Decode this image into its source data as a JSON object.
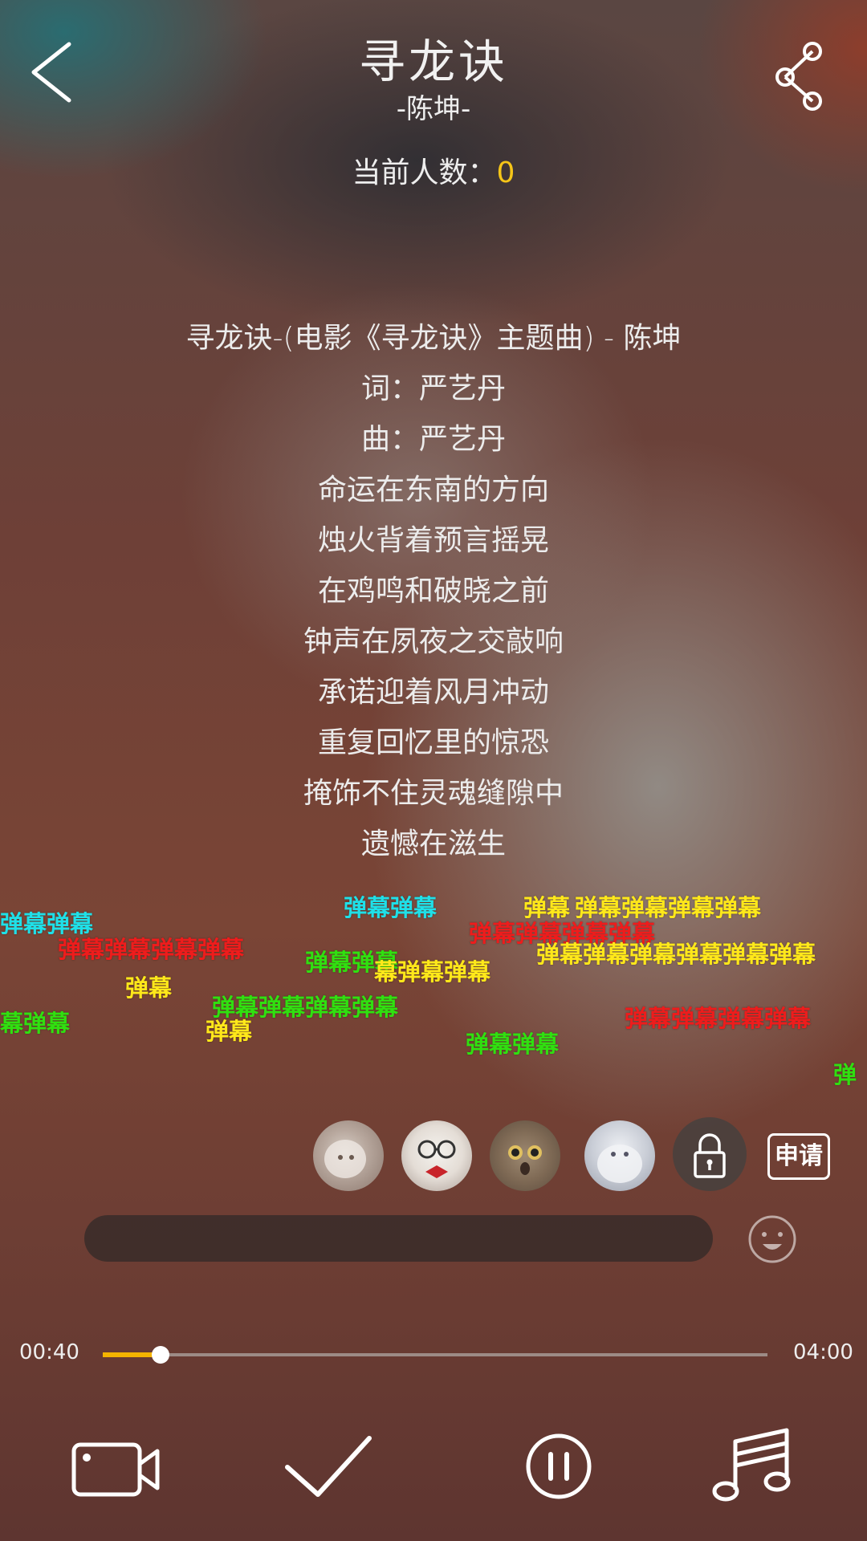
{
  "header": {
    "title": "寻龙诀",
    "subtitle": "-陈坤-",
    "online_label": "当前人数：",
    "online_count": "0"
  },
  "lyrics": [
    "寻龙诀-(电影《寻龙诀》主题曲) - 陈坤",
    "词：严艺丹",
    "曲：严艺丹",
    "命运在东南的方向",
    "烛火背着预言摇晃",
    "在鸡鸣和破晓之前",
    "钟声在夙夜之交敲响",
    "承诺迎着风月冲动",
    "重复回忆里的惊恐",
    "掩饰不住灵魂缝隙中",
    "遗憾在滋生"
  ],
  "danmaku": {
    "d1": "弹幕弹幕",
    "d2": "弹幕弹幕弹幕弹幕",
    "d3": "弹幕",
    "d4": "幕弹幕",
    "d5": "弹幕弹幕",
    "d6": "弹幕弹幕",
    "d7": "弹幕弹幕弹幕弹幕",
    "d8": "弹幕",
    "d9": "弹幕弹幕",
    "d10": "幕弹幕弹幕",
    "d11": "弹幕",
    "d12": "弹幕弹幕弹幕弹幕",
    "d13": "弹幕弹幕弹幕弹幕",
    "d14": "弹幕弹幕弹幕弹幕弹幕弹幕",
    "d15": "弹幕弹幕弹幕弹幕",
    "d16": "弹"
  },
  "room": {
    "apply_label": "申请"
  },
  "player": {
    "current_time": "00:40",
    "total_time": "04:00",
    "progress": 0.1667
  },
  "colors": {
    "accent": "#f5b400",
    "danmaku_red": "#ee1c1c",
    "danmaku_yellow": "#ffe81a",
    "danmaku_green": "#30e010",
    "danmaku_cyan": "#1fe0e8"
  },
  "icons": {
    "back": "chevron-left-icon",
    "share": "share-icon",
    "lock": "lock-icon",
    "emoji": "smiley-icon",
    "video": "video-camera-icon",
    "confirm": "check-icon",
    "pause": "pause-icon",
    "music": "music-note-icon"
  }
}
